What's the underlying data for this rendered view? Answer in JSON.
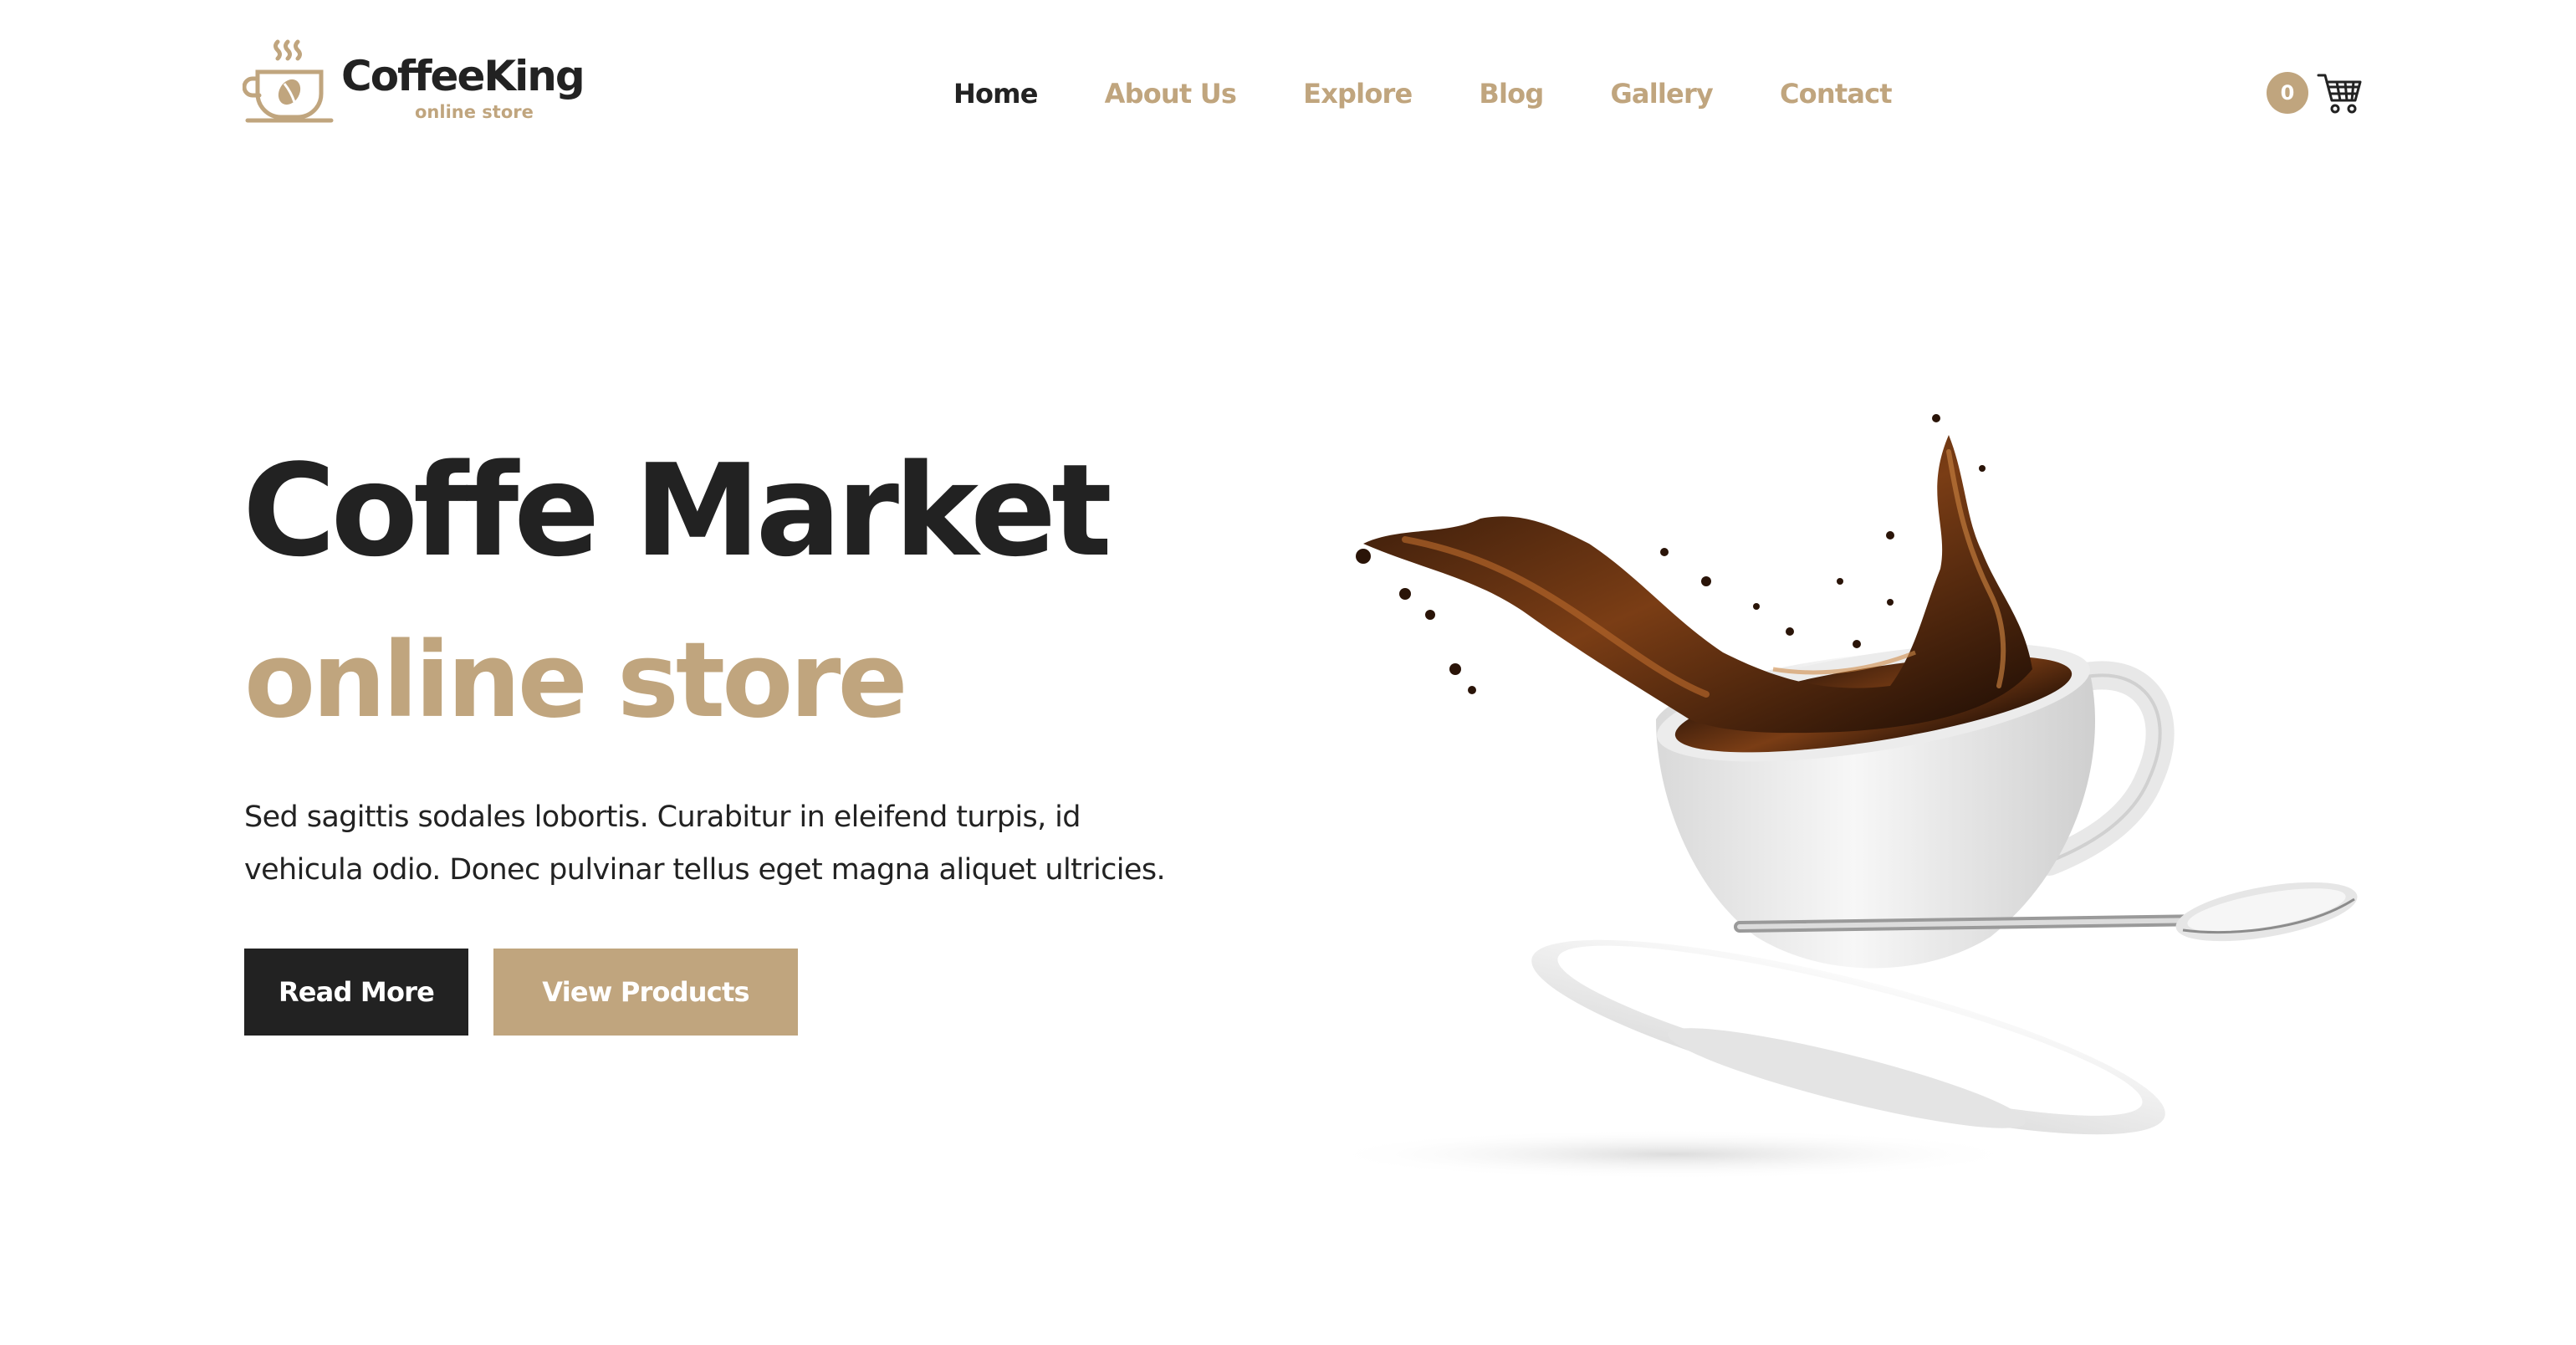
{
  "brand": {
    "name": "CoffeeKing",
    "tagline": "online store",
    "accent_color": "#c0a57e",
    "dark_color": "#222222",
    "logo_icon": "coffee-cup-icon"
  },
  "nav": {
    "items": [
      {
        "label": "Home",
        "active": true
      },
      {
        "label": "About Us",
        "active": false
      },
      {
        "label": "Explore",
        "active": false
      },
      {
        "label": "Blog",
        "active": false
      },
      {
        "label": "Gallery",
        "active": false
      },
      {
        "label": "Contact",
        "active": false
      }
    ]
  },
  "cart": {
    "count": "0",
    "icon": "shopping-cart-icon"
  },
  "hero": {
    "title": "Coffe Market",
    "subtitle": "online store",
    "text_line1": "Sed sagittis sodales lobortis. Curabitur in eleifend turpis, id",
    "text_line2": "vehicula odio. Donec pulvinar tellus eget magna aliquet ultricies.",
    "primary_button": "Read More",
    "secondary_button": "View Products",
    "image": "coffee-splash-cup-image"
  }
}
